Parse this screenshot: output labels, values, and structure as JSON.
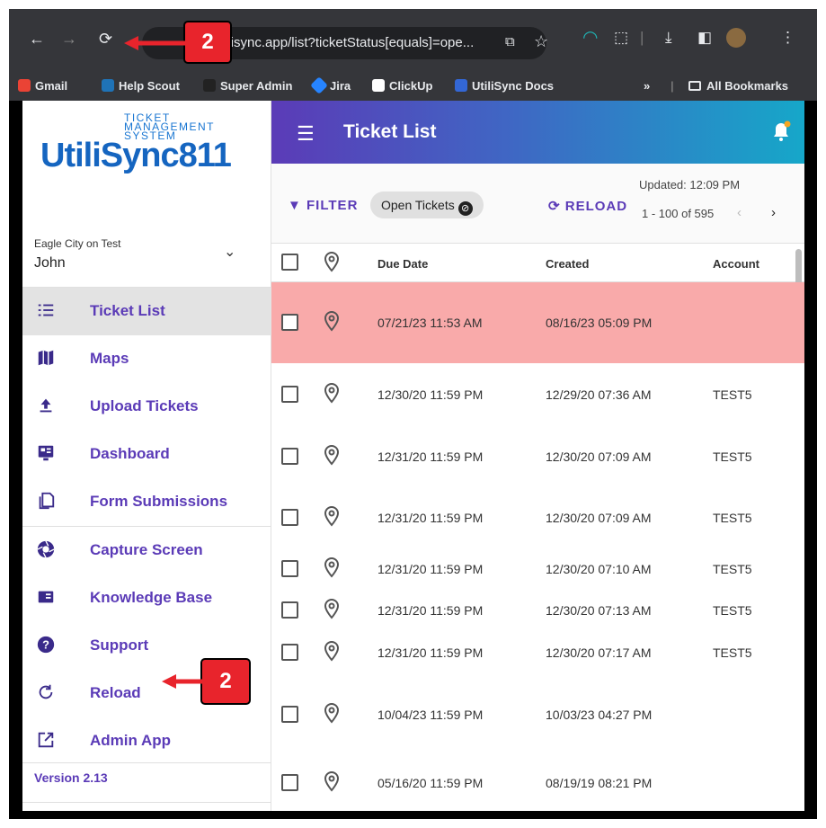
{
  "browser": {
    "url": "ilisync.app/list?ticketStatus[equals]=ope...",
    "bookmarks": [
      "Gmail",
      "Help Scout",
      "Super Admin",
      "Jira",
      "ClickUp",
      "UtiliSync Docs"
    ],
    "more": "»",
    "all_bookmarks": "All Bookmarks"
  },
  "logo": {
    "main": "UtiliSync811",
    "sub": "TICKET MANAGEMENT SYSTEM"
  },
  "account": {
    "org": "Eagle City on Test",
    "user": "John"
  },
  "nav": [
    {
      "label": "Ticket List",
      "icon": "list-icon"
    },
    {
      "label": "Maps",
      "icon": "map-icon"
    },
    {
      "label": "Upload Tickets",
      "icon": "upload-icon"
    },
    {
      "label": "Dashboard",
      "icon": "dashboard-icon"
    },
    {
      "label": "Form Submissions",
      "icon": "document-icon"
    },
    {
      "label": "Capture Screen",
      "icon": "camera-shutter-icon"
    },
    {
      "label": "Knowledge Base",
      "icon": "book-icon"
    },
    {
      "label": "Support",
      "icon": "help-icon"
    },
    {
      "label": "Reload",
      "icon": "reload-icon"
    },
    {
      "label": "Admin App",
      "icon": "external-link-icon"
    }
  ],
  "version": "Version 2.13",
  "header": {
    "title": "Ticket List"
  },
  "toolbar": {
    "filter": "FILTER",
    "chip": "Open Tickets",
    "reload": "RELOAD",
    "updated": "Updated: 12:09 PM",
    "pager": "1 - 100 of 595"
  },
  "table": {
    "columns": [
      "Due Date",
      "Created",
      "Account"
    ],
    "rows": [
      {
        "due": "07/21/23 11:53 AM",
        "created": "08/16/23 05:09 PM",
        "account": "",
        "highlight": true
      },
      {
        "due": "12/30/20 11:59 PM",
        "created": "12/29/20 07:36 AM",
        "account": "TEST5"
      },
      {
        "due": "12/31/20 11:59 PM",
        "created": "12/30/20 07:09 AM",
        "account": "TEST5"
      },
      {
        "due": "12/31/20 11:59 PM",
        "created": "12/30/20 07:09 AM",
        "account": "TEST5"
      },
      {
        "due": "12/31/20 11:59 PM",
        "created": "12/30/20 07:10 AM",
        "account": "TEST5"
      },
      {
        "due": "12/31/20 11:59 PM",
        "created": "12/30/20 07:13 AM",
        "account": "TEST5"
      },
      {
        "due": "12/31/20 11:59 PM",
        "created": "12/30/20 07:17 AM",
        "account": "TEST5"
      },
      {
        "due": "10/04/23 11:59 PM",
        "created": "10/03/23 04:27 PM",
        "account": ""
      },
      {
        "due": "05/16/20 11:59 PM",
        "created": "08/19/19 08:21 PM",
        "account": ""
      }
    ]
  },
  "annotations": {
    "step1": "2",
    "step2": "2"
  },
  "colors": {
    "accent": "#5b3bb7",
    "highlight_row": "#f9aaaa",
    "callout": "#e8242c"
  }
}
